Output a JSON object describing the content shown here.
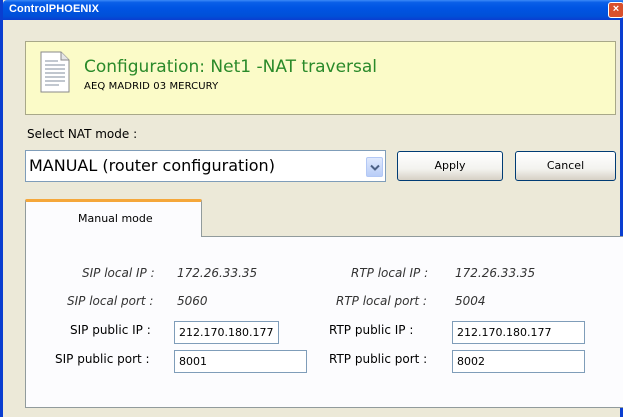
{
  "window": {
    "title": "ControlPHOENIX",
    "close_glyph": "×"
  },
  "banner": {
    "title": "Configuration: Net1 -NAT traversal",
    "subtitle": "AEQ MADRID 03 MERCURY",
    "icon": "document-icon",
    "title_color": "#2a8a2a",
    "background_color": "#fbfbc8"
  },
  "nat": {
    "label": "Select NAT mode :",
    "selected": "MANUAL (router configuration)"
  },
  "buttons": {
    "apply": "Apply",
    "cancel": "Cancel"
  },
  "tabs": [
    {
      "label": "Manual mode",
      "active": true,
      "accent_color": "#f5a73a"
    }
  ],
  "manual": {
    "sip_local_ip_label": "SIP local IP :",
    "sip_local_ip_value": "172.26.33.35",
    "rtp_local_ip_label": "RTP local IP :",
    "rtp_local_ip_value": "172.26.33.35",
    "sip_local_port_label": "SIP local port :",
    "sip_local_port_value": "5060",
    "rtp_local_port_label": "RTP local port :",
    "rtp_local_port_value": "5004",
    "sip_public_ip_label": "SIP public IP :",
    "sip_public_ip_value": "212.170.180.177",
    "rtp_public_ip_label": "RTP public IP :",
    "rtp_public_ip_value": "212.170.180.177",
    "sip_public_port_label": "SIP public port :",
    "sip_public_port_value": "8001",
    "rtp_public_port_label": "RTP public port :",
    "rtp_public_port_value": "8002"
  }
}
